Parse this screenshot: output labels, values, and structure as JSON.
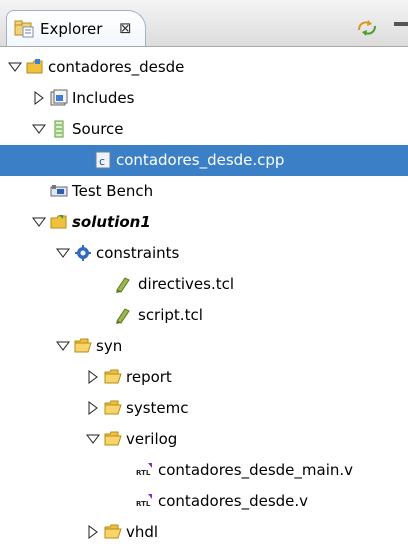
{
  "view": {
    "tab_title": "Explorer",
    "tab_close": "⊠",
    "icons": [
      "explorer-icon",
      "sync-icon",
      "minimize-icon"
    ]
  },
  "tree": {
    "project": "contadores_desde",
    "includes": "Includes",
    "source": "Source",
    "source_file": "contadores_desde.cpp",
    "test_bench": "Test Bench",
    "solution": "solution1",
    "constraints": "constraints",
    "directives": "directives.tcl",
    "script": "script.tcl",
    "syn": "syn",
    "report": "report",
    "systemc": "systemc",
    "verilog": "verilog",
    "verilog_main": "contadores_desde_main.v",
    "verilog_file": "contadores_desde.v",
    "vhdl": "vhdl"
  },
  "colors": {
    "selection": "#3b80c7",
    "folder": "#f0c040"
  }
}
